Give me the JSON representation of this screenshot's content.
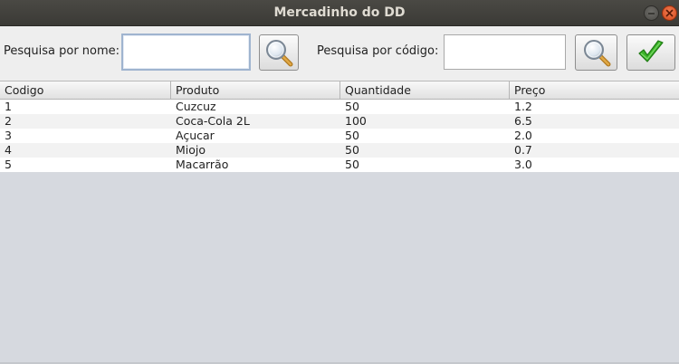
{
  "window": {
    "title": "Mercadinho do DD"
  },
  "search": {
    "name_label": "Pesquisa por nome:",
    "name_value": "",
    "code_label": "Pesquisa por código:",
    "code_value": ""
  },
  "icons": {
    "search_name": "magnifier-icon",
    "search_code": "magnifier-icon",
    "confirm": "checkmark-icon",
    "accent_check": "#3cb528"
  },
  "table": {
    "columns": [
      "Codigo",
      "Produto",
      "Quantidade",
      "Preço"
    ],
    "rows": [
      [
        "1",
        "Cuzcuz",
        "50",
        "1.2"
      ],
      [
        "2",
        "Coca-Cola 2L",
        "100",
        "6.5"
      ],
      [
        "3",
        "Açucar",
        "50",
        "2.0"
      ],
      [
        "4",
        "Miojo",
        "50",
        "0.7"
      ],
      [
        "5",
        "Macarrão",
        "50",
        "3.0"
      ]
    ]
  }
}
